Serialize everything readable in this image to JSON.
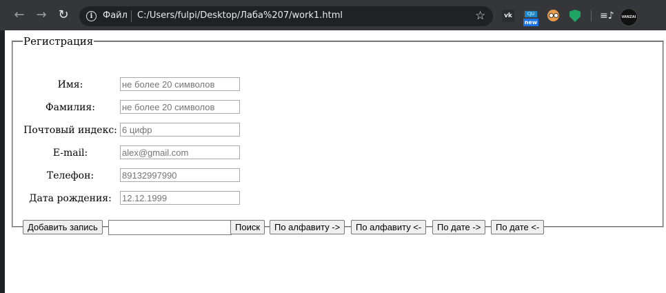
{
  "browser": {
    "file_label": "Файл",
    "url": "C:/Users/fulpi/Desktop/Лаба%207/work1.html",
    "extensions": {
      "vk_label": "vk",
      "new_top_label": "CJU",
      "new_badge_label": "new",
      "avatar_label": "VANZAI"
    }
  },
  "form": {
    "legend": "Регистрация",
    "fields": [
      {
        "label": "Имя:",
        "placeholder": "не более 20 символов",
        "value": ""
      },
      {
        "label": "Фамилия:",
        "placeholder": "не более 20 символов",
        "value": ""
      },
      {
        "label": "Почтовый индекс:",
        "placeholder": "6 цифр",
        "value": ""
      },
      {
        "label": "E-mail:",
        "placeholder": "alex@gmail.com",
        "value": ""
      },
      {
        "label": "Телефон:",
        "placeholder": "89132997990",
        "value": ""
      },
      {
        "label": "Дата рождения:",
        "placeholder": "12.12.1999",
        "value": ""
      }
    ],
    "buttons": {
      "add": "Добавить запись",
      "search_value": "",
      "search": "Поиск",
      "alpha_asc": "По алфавиту ->",
      "alpha_desc": "По алфавиту <-",
      "date_asc": "По дате ->",
      "date_desc": "По дате <-"
    }
  },
  "colors": {
    "chrome_bg": "#35363a",
    "omnibox_bg": "#202124",
    "page_bg": "#ffffff"
  }
}
